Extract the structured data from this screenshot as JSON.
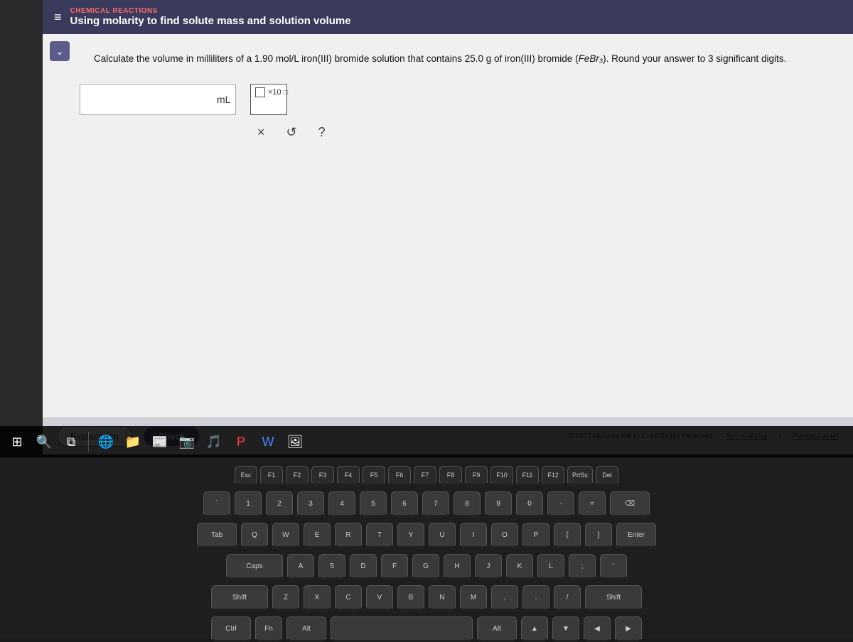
{
  "header": {
    "subtitle": "CHEMICAL REACTIONS",
    "title": "Using molarity to find solute mass and solution volume",
    "hamburger_label": "≡"
  },
  "question": {
    "text_part1": "Calculate the volume in milliliters of a 1.90 mol/L iron(III) bromide solution that contains 25.0 g of iron(III) bromide (",
    "formula": "FeBr₃",
    "text_part2": "). Round your answer to 3 significant digits.",
    "unit": "mL"
  },
  "controls": {
    "cross_label": "×",
    "undo_label": "↺",
    "help_label": "?"
  },
  "exponent": {
    "label": "×10",
    "superscript": "□"
  },
  "bottom_bar": {
    "explanation_label": "Explanation",
    "check_label": "Check",
    "copyright": "© 2022 McGraw Hill LLC. All Rights Reserved.",
    "terms_label": "Terms of Use",
    "privacy_label": "Privacy Center"
  },
  "taskbar": {
    "icons": [
      "⊞",
      "🔍",
      "📁",
      "📰",
      "🌐",
      "📷",
      "🎵",
      "📊",
      "🔴",
      "W",
      "🖼"
    ]
  }
}
